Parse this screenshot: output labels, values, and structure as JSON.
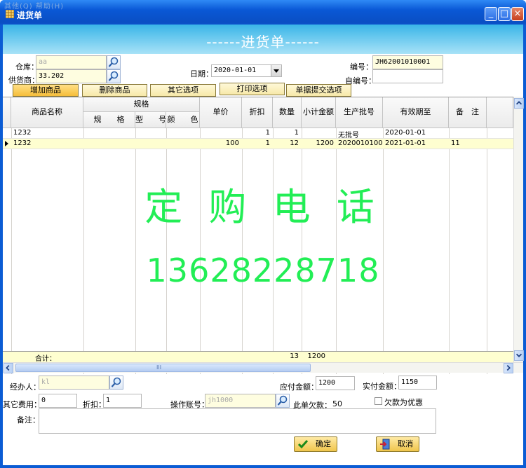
{
  "window": {
    "ghost_menu": "其他(Q)    帮助(H)",
    "title": "进货单",
    "minimize_icon": "minimize-icon",
    "maximize_icon": "maximize-icon",
    "close_icon": "close-icon"
  },
  "banner": {
    "title": "------进货单------"
  },
  "form": {
    "warehouse_label": "仓库：",
    "warehouse_value": "aa",
    "supplier_label": "供货商：",
    "supplier_value": "33.202",
    "date_label": "日期：",
    "date_value": "2020-01-01",
    "number_label": "编号：",
    "number_value": "JH62001010001",
    "custom_number_label": "自编号：",
    "custom_number_value": ""
  },
  "options": {
    "add_item": "增加商品",
    "delete_item": "删除商品",
    "other": "其它选项",
    "print": "打印选项",
    "submit": "单据提交选项"
  },
  "grid": {
    "headers": {
      "name": "商品名称",
      "spec_group": "规格",
      "spec": "规　　格",
      "model": "型　　号",
      "color": "颜　　色",
      "price": "单价",
      "discount": "折扣",
      "qty": "数量",
      "subtotal": "小计金额",
      "batch": "生产批号",
      "expiry": "有效期至",
      "note": "备　注"
    },
    "rows": [
      {
        "name": "1232",
        "price": "",
        "discount": "1",
        "qty": "1",
        "subtotal": "",
        "batch": "无批号",
        "expiry": "2020-01-01",
        "note": ""
      },
      {
        "name": "1232",
        "price": "100",
        "discount": "1",
        "qty": "12",
        "subtotal": "1200",
        "batch": "2020010100",
        "expiry": "2021-01-01",
        "note": "11"
      }
    ],
    "total_label": "合计：",
    "total_qty": "13",
    "total_amount": "1200",
    "hscroll_grip": "III"
  },
  "watermark": {
    "line1": "定 购 电 话",
    "line2": "13628228718",
    "color": "#22ee55"
  },
  "footer": {
    "handler_label": "经办人：",
    "handler_value": "kl",
    "payable_label": "应付金额：",
    "payable_value": "1200",
    "paid_label": "实付金额：",
    "paid_value": "1150",
    "other_fee_label": "其它费用：",
    "other_fee_value": "0",
    "discount_label": "折扣：",
    "discount_value": "1",
    "account_label": "操作账号：",
    "account_value": "jh1000",
    "debt_label": "此单欠款：",
    "debt_value": "50",
    "debt_as_discount_label": "欠款为优惠",
    "note_label": "备注：",
    "note_value": "",
    "ok_label": "确定",
    "cancel_label": "取消"
  }
}
